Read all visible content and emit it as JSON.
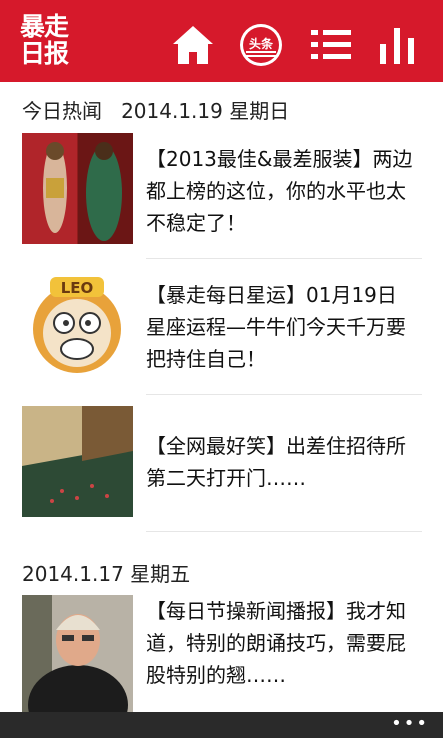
{
  "app": {
    "logo_line1": "暴走",
    "logo_line2": "日报",
    "accent": "#d6192b"
  },
  "toolbar": {
    "icons": [
      "home-icon",
      "headline-icon",
      "list-icon",
      "chart-icon"
    ],
    "headline_badge": "头条"
  },
  "sections": [
    {
      "header": "今日热闻   2014.1.19 星期日",
      "items": [
        {
          "title": "【2013最佳&最差服装】两边都上榜的这位，你的水平也太不稳定了！"
        },
        {
          "title": "【暴走每日星运】01月19日星座运程—牛牛们今天千万要把持住自己！",
          "thumb_text": "LEO"
        },
        {
          "title": "【全网最好笑】出差住招待所第二天打开门……"
        }
      ]
    },
    {
      "header": "2014.1.17 星期五",
      "items": [
        {
          "title": "【每日节操新闻播报】我才知道，特别的朗诵技巧，需要屁股特别的翘……"
        }
      ]
    }
  ],
  "bottom_bar": {
    "more_label": "•••"
  }
}
